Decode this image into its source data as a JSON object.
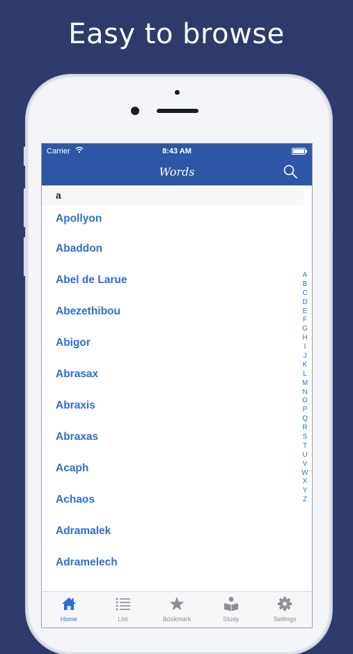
{
  "headline": "Easy to browse",
  "status": {
    "carrier": "Carrier",
    "time": "8:43 AM"
  },
  "nav": {
    "title": "Words"
  },
  "section": {
    "letter": "a"
  },
  "words": [
    "Apollyon",
    "Abaddon",
    "Abel de Larue",
    "Abezethibou",
    "Abigor",
    "Abrasax",
    "Abraxis",
    "Abraxas",
    "Acaph",
    "Achaos",
    "Adramalek",
    "Adramelech"
  ],
  "index": [
    "A",
    "B",
    "C",
    "D",
    "E",
    "F",
    "G",
    "H",
    "I",
    "J",
    "K",
    "L",
    "M",
    "N",
    "O",
    "P",
    "Q",
    "R",
    "S",
    "T",
    "U",
    "V",
    "W",
    "X",
    "Y",
    "Z"
  ],
  "tabs": [
    {
      "label": "Home",
      "icon": "home-icon"
    },
    {
      "label": "List",
      "icon": "list-icon"
    },
    {
      "label": "Bookmark",
      "icon": "star-icon"
    },
    {
      "label": "Study",
      "icon": "reader-icon"
    },
    {
      "label": "Settings",
      "icon": "gear-icon"
    }
  ],
  "colors": {
    "background": "#2e3a6b",
    "accent": "#2d57a6",
    "link": "#2d6fd3"
  }
}
